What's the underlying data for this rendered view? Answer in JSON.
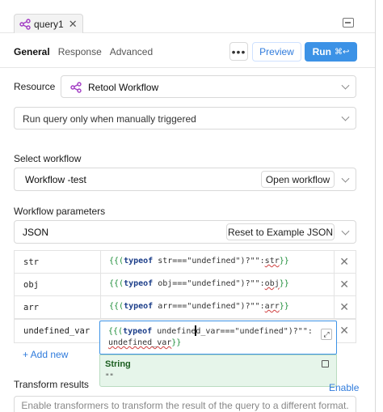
{
  "header": {
    "query_chip": {
      "label": "query1",
      "icon": "workflow-icon",
      "close_glyph": "✕"
    },
    "collapse_icon": "collapse-panel-icon"
  },
  "tabs": [
    {
      "label": "General",
      "active": true
    },
    {
      "label": "Response",
      "active": false
    },
    {
      "label": "Advanced",
      "active": false
    }
  ],
  "toolbar": {
    "more_label": "•••",
    "preview_label": "Preview",
    "run_label": "Run",
    "run_shortcut": "⌘↩",
    "run_color": "#3c92e6"
  },
  "resource": {
    "label": "Resource",
    "value": "Retool Workflow",
    "icon": "workflow-icon"
  },
  "trigger": {
    "value": "Run query only when manually triggered"
  },
  "workflow": {
    "label": "Select workflow",
    "value": "Workflow -test",
    "open_button": "Open workflow"
  },
  "params": {
    "label": "Workflow parameters",
    "format": "JSON",
    "reset_button": "Reset to Example JSON",
    "rows": [
      {
        "key": "str",
        "code_pre": "{{(",
        "kw": "typeof",
        "code_mid": " str===\"undefined\")?\"\":",
        "var": "str",
        "code_post": "}}"
      },
      {
        "key": "obj",
        "code_pre": "{{(",
        "kw": "typeof",
        "code_mid": " obj===\"undefined\")?\"\":",
        "var": "obj",
        "code_post": "}}"
      },
      {
        "key": "arr",
        "code_pre": "{{(",
        "kw": "typeof",
        "code_mid": " arr===\"undefined\")?\"\":",
        "var": "arr",
        "code_post": "}}"
      },
      {
        "key": "undefined_var",
        "code_pre": "{{(",
        "kw": "typeof",
        "code_mid": " undefined_var===\"undefined\")?\"\":",
        "var": "undefined_var",
        "code_post": "}}"
      }
    ],
    "active_line1_pre": "{{(",
    "active_line1_kw": "typeof",
    "active_line1_rest": " undefined_var===\"undefined\")?\"\":",
    "active_line2_var": "undefined_var",
    "active_line2_post": "}}",
    "add_new": "+ Add new",
    "remove_glyph": "✕"
  },
  "eval_popup": {
    "type": "String",
    "value": "\"\""
  },
  "transform": {
    "label": "Transform results",
    "enable_link": "Enable",
    "hint": "Enable transformers to transform the result of the query to a different format."
  }
}
